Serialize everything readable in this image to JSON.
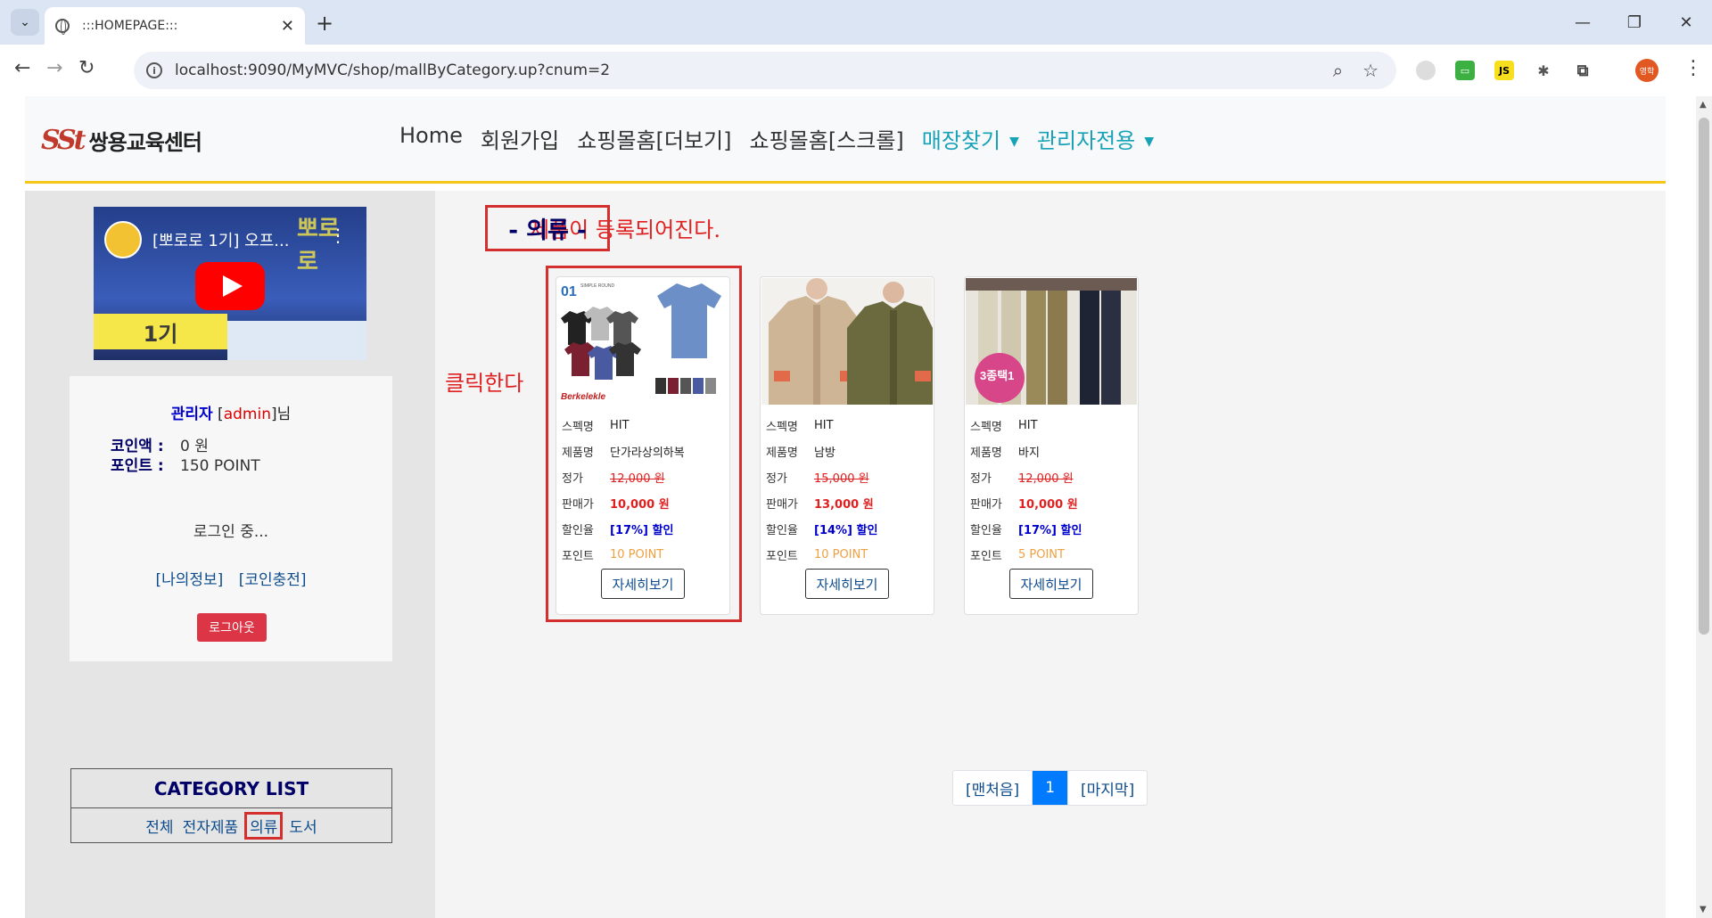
{
  "browser": {
    "tab_title": ":::HOMEPAGE:::",
    "url": "localhost:9090/MyMVC/shop/mallByCategory.up?cnum=2",
    "profile_label": "영학"
  },
  "site": {
    "logo_mark": "SSt",
    "logo_text": "쌍용교육센터",
    "nav": [
      "Home",
      "회원가입",
      "쇼핑몰홈[더보기]",
      "쇼핑몰홈[스크롤]"
    ],
    "nav_dropdowns": [
      "매장찾기",
      "관리자전용"
    ]
  },
  "video": {
    "title": "[뽀로로 1기] 오프...",
    "badge": "1기"
  },
  "login": {
    "user_title": "관리자",
    "user_id": "admin",
    "user_suffix": "님",
    "coin_label": "코인액 :",
    "coin_value": "0 원",
    "point_label": "포인트 :",
    "point_value": "150 POINT",
    "status": "로그인 중...",
    "link_myinfo": "[나의정보]",
    "link_coin": "[코인충전]",
    "logout": "로그아웃"
  },
  "category": {
    "title": "CATEGORY LIST",
    "items": [
      "전체",
      "전자제품",
      "의류",
      "도서"
    ],
    "active_index": 2
  },
  "annotations": {
    "registered": "제품이 등록되어진다.",
    "click": "클릭한다"
  },
  "content": {
    "heading": "- 의류 -"
  },
  "labels": {
    "spec": "스펙명",
    "name": "제품명",
    "price": "정가",
    "sale": "판매가",
    "discount": "할인율",
    "point": "포인트",
    "detail": "자세히보기"
  },
  "products": [
    {
      "spec": "HIT",
      "name": "단가라상의하복",
      "price": "12,000 원",
      "sale": "10,000 원",
      "discount": "[17%] 할인",
      "point": "10 POINT"
    },
    {
      "spec": "HIT",
      "name": "남방",
      "price": "15,000 원",
      "sale": "13,000 원",
      "discount": "[14%] 할인",
      "point": "10 POINT"
    },
    {
      "spec": "HIT",
      "name": "바지",
      "price": "12,000 원",
      "sale": "10,000 원",
      "discount": "[17%] 할인",
      "point": "5 POINT"
    }
  ],
  "pagination": {
    "first": "[맨처음]",
    "current": "1",
    "last": "[마지막]"
  },
  "colors": {
    "accent_red": "#d32f2f",
    "link_blue": "#0d4b8c",
    "nav_teal": "#17a2b8",
    "header_rule": "#f5c518"
  }
}
